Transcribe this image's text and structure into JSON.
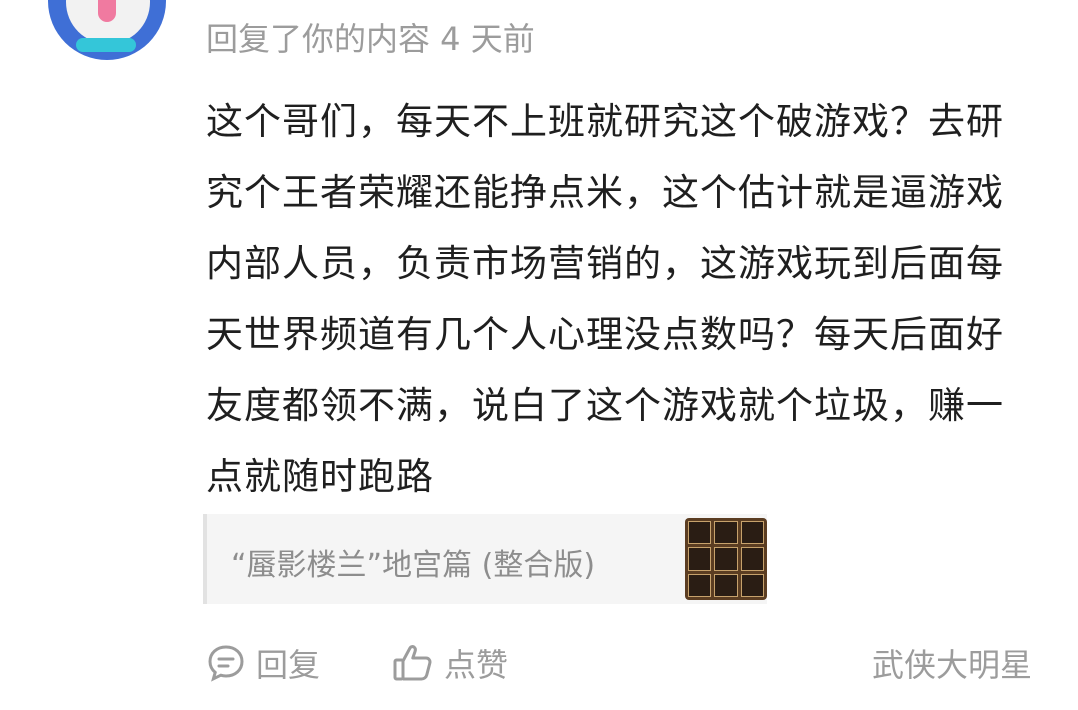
{
  "comment": {
    "meta": "回复了你的内容 4 天前",
    "content": "这个哥们，每天不上班就研究这个破游戏？去研究个王者荣耀还能挣点米，这个估计就是逼游戏内部人员，负责市场营销的，这游戏玩到后面每天世界频道有几个人心理没点数吗？每天后面好友度都领不满，说白了这个游戏就个垃圾，赚一点就随时跑路"
  },
  "reference": {
    "title": "“蜃影楼兰”地宫篇 (整合版)"
  },
  "actions": {
    "reply_label": "回复",
    "like_label": "点赞"
  },
  "author": "武侠大明星",
  "icons": {
    "reply": "chat-bubble-icon",
    "like": "thumbs-up-icon"
  }
}
